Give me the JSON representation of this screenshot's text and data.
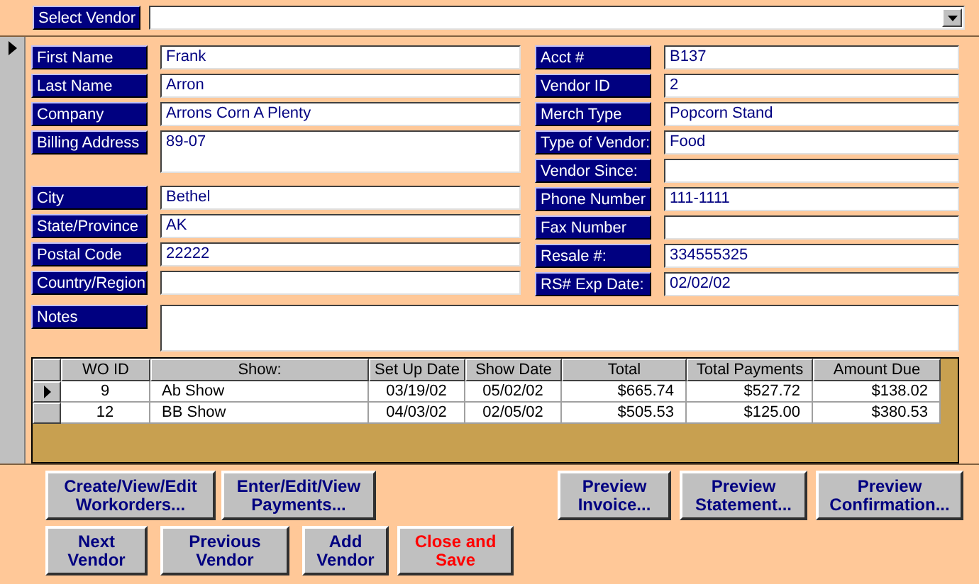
{
  "select_vendor": {
    "label": "Select Vendor"
  },
  "left_fields": [
    {
      "label": "First Name",
      "value": "Frank",
      "kind": "single"
    },
    {
      "label": "Last Name",
      "value": "Arron",
      "kind": "single"
    },
    {
      "label": "Company",
      "value": "Arrons Corn A Plenty",
      "kind": "single"
    },
    {
      "label": "Billing Address",
      "value": "89-07",
      "kind": "multi"
    },
    {
      "label": "City",
      "value": "Bethel",
      "kind": "single"
    },
    {
      "label": "State/Province",
      "value": "AK",
      "kind": "single"
    },
    {
      "label": "Postal Code",
      "value": "22222",
      "kind": "single"
    },
    {
      "label": "Country/Region",
      "kind": "single"
    }
  ],
  "right_fields": [
    {
      "label": "Acct #",
      "value": "B137"
    },
    {
      "label": "Vendor ID",
      "value": "2"
    },
    {
      "label": "Merch Type",
      "value": "Popcorn Stand"
    },
    {
      "label": "Type of Vendor:",
      "value": "Food"
    },
    {
      "label": "Vendor Since:"
    },
    {
      "label": "Phone Number",
      "value": "111-1111"
    },
    {
      "label": "Fax Number"
    },
    {
      "label": "Resale #:",
      "value": "334555325"
    },
    {
      "label": "RS# Exp Date:",
      "value": "02/02/02"
    }
  ],
  "notes": {
    "label": "Notes"
  },
  "workorders": {
    "columns": [
      "WO ID",
      "Show:",
      "Set Up Date",
      "Show Date",
      "Total",
      "Total Payments",
      "Amount Due"
    ],
    "rows": [
      {
        "selected": true,
        "cells": [
          "9",
          "Ab Show",
          "03/19/02",
          "05/02/02",
          "$665.74",
          "$527.72",
          "$138.02"
        ]
      },
      {
        "selected": false,
        "cells": [
          "12",
          "BB Show",
          "04/03/02",
          "02/05/02",
          "$505.53",
          "$125.00",
          "$380.53"
        ]
      }
    ]
  },
  "button_rows": [
    [
      {
        "lines": [
          "Create/View/Edit",
          "Workorders..."
        ],
        "kind": "normal"
      },
      {
        "lines": [
          "Enter/Edit/View",
          "Payments..."
        ],
        "kind": "normal"
      },
      {
        "lines": [
          "Preview",
          "Invoice..."
        ],
        "kind": "normal"
      },
      {
        "lines": [
          "Preview",
          "Statement..."
        ],
        "kind": "normal"
      },
      {
        "lines": [
          "Preview",
          "Confirmation..."
        ],
        "kind": "normal"
      }
    ],
    [
      {
        "lines": [
          "Next",
          "Vendor"
        ],
        "kind": "normal"
      },
      {
        "lines": [
          "Previous",
          "Vendor"
        ],
        "kind": "normal"
      },
      {
        "lines": [
          "Add",
          "Vendor"
        ],
        "kind": "normal"
      },
      {
        "lines": [
          "Close and",
          "Save"
        ],
        "kind": "danger"
      }
    ]
  ]
}
